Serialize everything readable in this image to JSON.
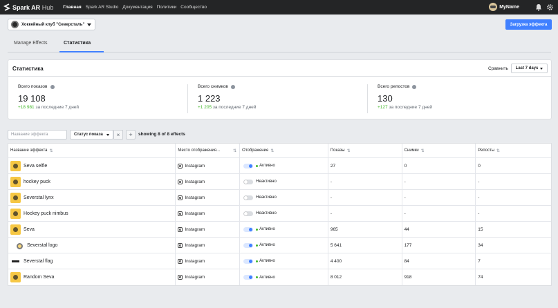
{
  "brand": {
    "name": "Spark AR",
    "suffix": "Hub"
  },
  "nav": [
    "Главная",
    "Spark AR Studio",
    "Документация",
    "Политики",
    "Сообщество"
  ],
  "user": {
    "name": "MyName"
  },
  "project": {
    "name": "Хоккейный клуб \"Северсталь\""
  },
  "upload_button": "Загрузка эффекта",
  "tabs": [
    "Manage Effects",
    "Статистика"
  ],
  "stats": {
    "title": "Статистика",
    "compare_label": "Сравнить",
    "period": "Last 7 days",
    "items": [
      {
        "label": "Всего показов",
        "value": "19 108",
        "delta": "+18 981",
        "delta_text": "за последние 7 дней"
      },
      {
        "label": "Всего снимков",
        "value": "1 223",
        "delta": "+1 205",
        "delta_text": "за последние 7 дней"
      },
      {
        "label": "Всего репостов",
        "value": "130",
        "delta": "+127",
        "delta_text": "за последние 7 дней"
      }
    ]
  },
  "filters": {
    "search_placeholder": "Название эффекта",
    "status_filter": "Статус показа",
    "clear": "×",
    "add": "+",
    "showing": "showing 8 of 8 effects"
  },
  "table": {
    "headers": [
      "Название эффекта",
      "Место отображения...",
      "Отображение",
      "Показы",
      "Снимки",
      "Репосты"
    ],
    "rows": [
      {
        "name": "Seva selfie",
        "platform": "Instagram",
        "active": true,
        "status": "Активно",
        "views": "27",
        "captures": "0",
        "shares": "0"
      },
      {
        "name": "hockey puck",
        "platform": "Instagram",
        "active": false,
        "status": "Неактивно",
        "views": "-",
        "captures": "-",
        "shares": "-"
      },
      {
        "name": "Severstal lynx",
        "platform": "Instagram",
        "active": false,
        "status": "Неактивно",
        "views": "-",
        "captures": "-",
        "shares": "-"
      },
      {
        "name": "Hockey puck nimbus",
        "platform": "Instagram",
        "active": false,
        "status": "Неактивно",
        "views": "-",
        "captures": "-",
        "shares": "-"
      },
      {
        "name": "Seva",
        "platform": "Instagram",
        "active": true,
        "status": "Активно",
        "views": "965",
        "captures": "44",
        "shares": "15"
      },
      {
        "name": "Severstal logo",
        "platform": "Instagram",
        "active": true,
        "status": "Активно",
        "views": "5 641",
        "captures": "177",
        "shares": "34"
      },
      {
        "name": "Severstal flag",
        "platform": "Instagram",
        "active": true,
        "status": "Активно",
        "views": "4 400",
        "captures": "84",
        "shares": "7"
      },
      {
        "name": "Random Seva",
        "platform": "Instagram",
        "active": true,
        "status": "Активно",
        "views": "8 012",
        "captures": "918",
        "shares": "74"
      }
    ]
  }
}
